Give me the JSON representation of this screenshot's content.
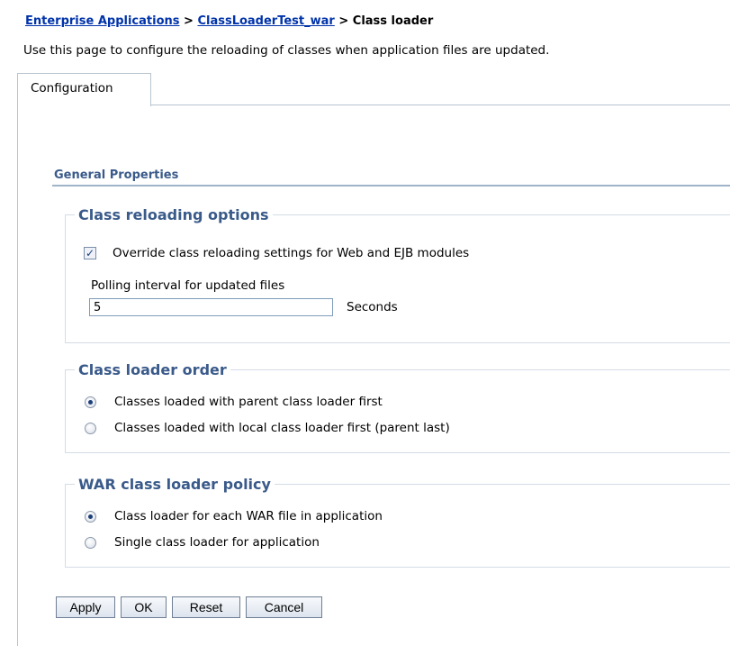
{
  "breadcrumb": {
    "link1": "Enterprise Applications",
    "sep1": " > ",
    "link2": "ClassLoaderTest_war",
    "sep2": " > ",
    "current": "Class loader"
  },
  "description": "Use this page to configure the reloading of classes when application files are updated.",
  "tabs": [
    {
      "label": "Configuration",
      "active": true
    }
  ],
  "general_properties": "General Properties",
  "class_reloading": {
    "legend": "Class reloading options",
    "override_label": "Override class reloading settings for Web and EJB modules",
    "override_checked": true,
    "polling_label": "Polling interval for updated files",
    "polling_value": "5",
    "polling_units": "Seconds"
  },
  "class_loader_order": {
    "legend": "Class loader order",
    "options": [
      {
        "label": "Classes loaded with parent class loader first",
        "selected": true
      },
      {
        "label": "Classes loaded with local class loader first (parent last)",
        "selected": false
      }
    ]
  },
  "war_policy": {
    "legend": "WAR class loader policy",
    "options": [
      {
        "label": "Class loader for each WAR file in application",
        "selected": true
      },
      {
        "label": "Single class loader for application",
        "selected": false
      }
    ]
  },
  "buttons": {
    "apply": "Apply",
    "ok": "OK",
    "reset": "Reset",
    "cancel": "Cancel"
  },
  "colors": {
    "section_title": "#3a5a8a",
    "link": "#0033aa"
  }
}
